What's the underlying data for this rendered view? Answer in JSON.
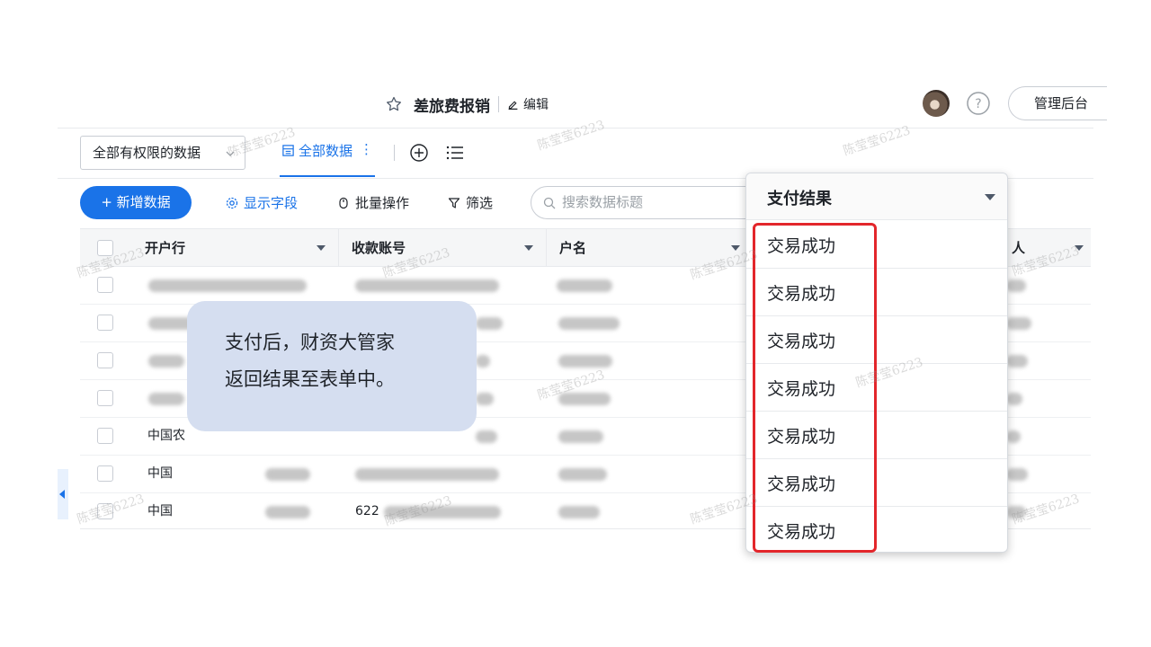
{
  "header": {
    "title": "差旅费报销",
    "edit_label": "编辑",
    "admin_label": "管理后台"
  },
  "views": {
    "selector_label": "全部有权限的数据",
    "active_tab": "全部数据",
    "more_glyph": "⋮"
  },
  "toolbar": {
    "add_label": "+ 新增数据",
    "show_fields": "显示字段",
    "batch": "批量操作",
    "filter": "筛选",
    "search_placeholder": "搜索数据标题"
  },
  "table": {
    "columns": [
      "开户行",
      "收款账号",
      "户名",
      "人"
    ],
    "rows": [
      {
        "bank": "",
        "account": "",
        "name": ""
      },
      {
        "bank": "",
        "account": "",
        "name": ""
      },
      {
        "bank": "",
        "account": "",
        "name": ""
      },
      {
        "bank": "",
        "account": "",
        "name": ""
      },
      {
        "bank": "中国农",
        "account": "",
        "name": ""
      },
      {
        "bank": "中国",
        "account": "",
        "name": ""
      },
      {
        "bank": "中国",
        "account": "622",
        "name": ""
      }
    ]
  },
  "callout": {
    "line1": "支付后，财资大管家",
    "line2": "返回结果至表单中。"
  },
  "dropdown": {
    "title": "支付结果",
    "items": [
      "交易成功",
      "交易成功",
      "交易成功",
      "交易成功",
      "交易成功",
      "交易成功",
      "交易成功"
    ]
  },
  "watermark": "陈莹莹6223",
  "colors": {
    "primary": "#1a73e8",
    "highlight": "#e3262b",
    "callout_bg": "#d5def0"
  }
}
